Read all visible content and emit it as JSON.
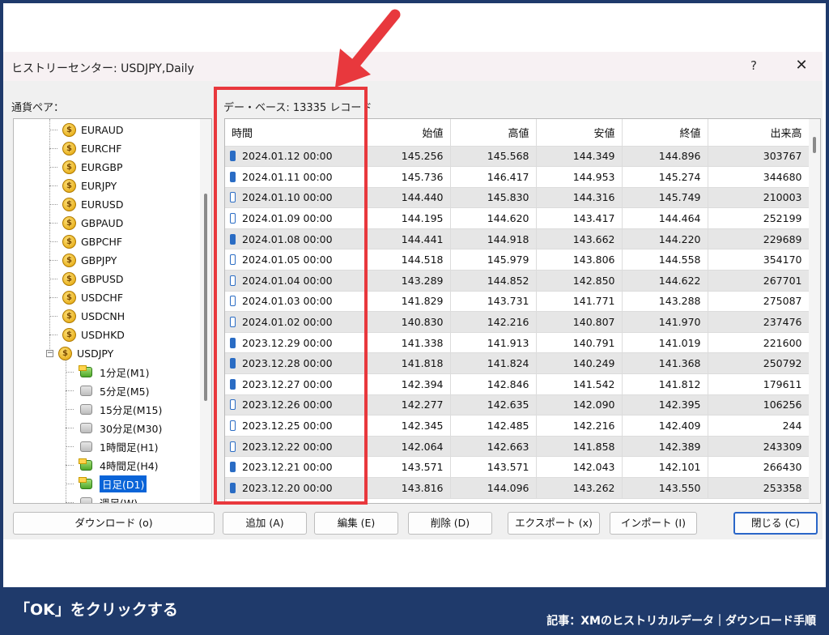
{
  "window": {
    "title": "ヒストリーセンター: USDJPY,Daily",
    "help_label": "?",
    "close_label": "✕"
  },
  "tree": {
    "label": "通貨ペア：",
    "pairs": [
      "EURAUD",
      "EURCHF",
      "EURGBP",
      "EURJPY",
      "EURUSD",
      "GBPAUD",
      "GBPCHF",
      "GBPJPY",
      "GBPUSD",
      "USDCHF",
      "USDCNH",
      "USDHKD"
    ],
    "expanded_pair": "USDJPY",
    "expander_symbol": "−",
    "coin_symbol": "$",
    "timeframes": [
      "1分足(M1)",
      "5分足(M5)",
      "15分足(M15)",
      "30分足(M30)",
      "1時間足(H1)",
      "4時間足(H4)",
      "日足(D1)",
      "週足(W)"
    ],
    "active_timeframes": [
      "1分足(M1)",
      "4時間足(H4)",
      "日足(D1)"
    ],
    "selected_timeframe": "日足(D1)"
  },
  "database": {
    "label": "デー・ベース: 13335 レコード"
  },
  "table": {
    "headers": {
      "time": "時間",
      "open": "始値",
      "high": "高値",
      "low": "安値",
      "close": "終値",
      "volume": "出来高"
    },
    "rows": [
      {
        "time": "2024.01.12 00:00",
        "open": "145.256",
        "high": "145.568",
        "low": "144.349",
        "close": "144.896",
        "volume": "303767"
      },
      {
        "time": "2024.01.11 00:00",
        "open": "145.736",
        "high": "146.417",
        "low": "144.953",
        "close": "145.274",
        "volume": "344680"
      },
      {
        "time": "2024.01.10 00:00",
        "open": "144.440",
        "high": "145.830",
        "low": "144.316",
        "close": "145.749",
        "volume": "210003"
      },
      {
        "time": "2024.01.09 00:00",
        "open": "144.195",
        "high": "144.620",
        "low": "143.417",
        "close": "144.464",
        "volume": "252199"
      },
      {
        "time": "2024.01.08 00:00",
        "open": "144.441",
        "high": "144.918",
        "low": "143.662",
        "close": "144.220",
        "volume": "229689"
      },
      {
        "time": "2024.01.05 00:00",
        "open": "144.518",
        "high": "145.979",
        "low": "143.806",
        "close": "144.558",
        "volume": "354170"
      },
      {
        "time": "2024.01.04 00:00",
        "open": "143.289",
        "high": "144.852",
        "low": "142.850",
        "close": "144.622",
        "volume": "267701"
      },
      {
        "time": "2024.01.03 00:00",
        "open": "141.829",
        "high": "143.731",
        "low": "141.771",
        "close": "143.288",
        "volume": "275087"
      },
      {
        "time": "2024.01.02 00:00",
        "open": "140.830",
        "high": "142.216",
        "low": "140.807",
        "close": "141.970",
        "volume": "237476"
      },
      {
        "time": "2023.12.29 00:00",
        "open": "141.338",
        "high": "141.913",
        "low": "140.791",
        "close": "141.019",
        "volume": "221600"
      },
      {
        "time": "2023.12.28 00:00",
        "open": "141.818",
        "high": "141.824",
        "low": "140.249",
        "close": "141.368",
        "volume": "250792"
      },
      {
        "time": "2023.12.27 00:00",
        "open": "142.394",
        "high": "142.846",
        "low": "141.542",
        "close": "141.812",
        "volume": "179611"
      },
      {
        "time": "2023.12.26 00:00",
        "open": "142.277",
        "high": "142.635",
        "low": "142.090",
        "close": "142.395",
        "volume": "106256"
      },
      {
        "time": "2023.12.25 00:00",
        "open": "142.345",
        "high": "142.485",
        "low": "142.216",
        "close": "142.409",
        "volume": "244"
      },
      {
        "time": "2023.12.22 00:00",
        "open": "142.064",
        "high": "142.663",
        "low": "141.858",
        "close": "142.389",
        "volume": "243309"
      },
      {
        "time": "2023.12.21 00:00",
        "open": "143.571",
        "high": "143.571",
        "low": "142.043",
        "close": "142.101",
        "volume": "266430"
      },
      {
        "time": "2023.12.20 00:00",
        "open": "143.816",
        "high": "144.096",
        "low": "143.262",
        "close": "143.550",
        "volume": "253358"
      }
    ]
  },
  "buttons": {
    "download": "ダウンロード (o)",
    "add": "追加 (A)",
    "edit": "編集 (E)",
    "delete": "削除 (D)",
    "export": "エクスポート (x)",
    "import": "インポート (I)",
    "close": "閉じる (C)"
  },
  "footer": {
    "caption": "「OK」をクリックする",
    "credit": "記事：XMのヒストリカルデータ｜ダウンロード手順"
  },
  "colors": {
    "background": "#1f3a6b",
    "highlight": "#e8383d",
    "selection": "#0a64d8",
    "candle": "#2a6cc4"
  }
}
